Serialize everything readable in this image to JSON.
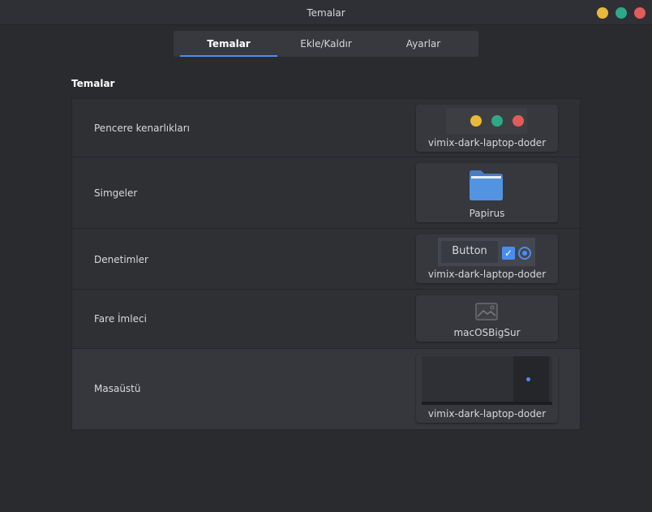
{
  "window": {
    "title": "Temalar",
    "buttons": {
      "minimize": "#e8b93a",
      "maximize": "#2fa889",
      "close": "#e25c5c"
    }
  },
  "tabs": [
    {
      "label": "Temalar",
      "active": true
    },
    {
      "label": "Ekle/Kaldır"
    },
    {
      "label": "Ayarlar"
    }
  ],
  "section": {
    "title": "Temalar"
  },
  "rows": [
    {
      "label": "Pencere kenarlıkları",
      "value": "vimix-dark-laptop-doder"
    },
    {
      "label": "Simgeler",
      "value": "Papirus"
    },
    {
      "label": "Denetimler",
      "value": "vimix-dark-laptop-doder",
      "preview_button": "Button"
    },
    {
      "label": "Fare İmleci",
      "value": "macOSBigSur"
    },
    {
      "label": "Masaüstü",
      "value": "vimix-dark-laptop-doder",
      "selected": true
    }
  ],
  "accent": "#4a8df0"
}
